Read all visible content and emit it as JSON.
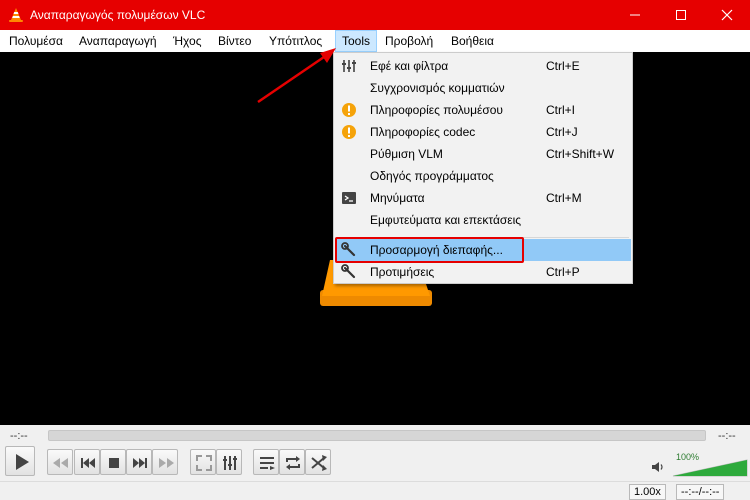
{
  "window": {
    "title": "Αναπαραγωγός πολυμέσων VLC",
    "controls": [
      "minimize",
      "maximize",
      "close"
    ]
  },
  "menubar": {
    "items": [
      "Πολυμέσα",
      "Αναπαραγωγή",
      "Ήχος",
      "Βίντεο",
      "Υπότιτλος",
      "Tools",
      "Προβολή",
      "Βοήθεια"
    ],
    "active": "Tools"
  },
  "tools_menu": {
    "items": [
      {
        "label": "Εφέ και φίλτρα",
        "shortcut": "Ctrl+E",
        "icon": "equalizer-icon"
      },
      {
        "label": "Συγχρονισμός κομματιών",
        "shortcut": "",
        "icon": ""
      },
      {
        "label": "Πληροφορίες πολυμέσου",
        "shortcut": "Ctrl+I",
        "icon": "info-icon"
      },
      {
        "label": "Πληροφορίες codec",
        "shortcut": "Ctrl+J",
        "icon": "info-icon"
      },
      {
        "label": "Ρύθμιση VLM",
        "shortcut": "Ctrl+Shift+W",
        "icon": ""
      },
      {
        "label": "Οδηγός προγράμματος",
        "shortcut": "",
        "icon": ""
      },
      {
        "label": "Μηνύματα",
        "shortcut": "Ctrl+M",
        "icon": "terminal-icon"
      },
      {
        "label": "Εμφυτεύματα και επεκτάσεις",
        "shortcut": "",
        "icon": ""
      },
      {
        "label": "Προσαρμογή διεπαφής...",
        "shortcut": "",
        "icon": "wrench-icon",
        "highlighted": true
      },
      {
        "label": "Προτιμήσεις",
        "shortcut": "Ctrl+P",
        "icon": "wrench-icon"
      }
    ]
  },
  "player": {
    "time_elapsed": "--:--",
    "time_total": "--:--",
    "volume": "100%",
    "speed": "1.00x",
    "time_display": "--:--/--:--"
  },
  "colors": {
    "titlebar": "#e60000",
    "menu_highlight": "#91c9f7",
    "annotation": "#e60000",
    "volume_green": "#2eaa3c"
  }
}
